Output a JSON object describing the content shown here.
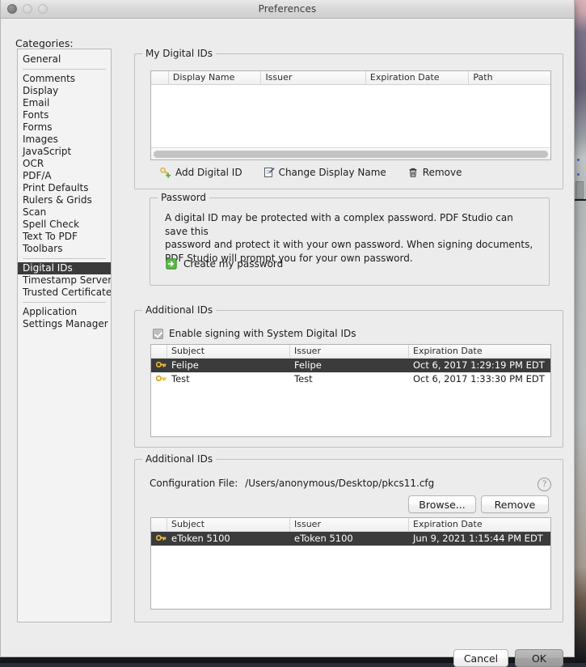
{
  "window": {
    "title": "Preferences",
    "traffic_lights": [
      "close-button",
      "minimize-button",
      "zoom-button"
    ]
  },
  "sidebar": {
    "label": "Categories:",
    "groups": [
      {
        "items": [
          {
            "label": "General",
            "selected": false
          }
        ]
      },
      {
        "items": [
          {
            "label": "Comments",
            "selected": false
          },
          {
            "label": "Display",
            "selected": false
          },
          {
            "label": "Email",
            "selected": false
          },
          {
            "label": "Fonts",
            "selected": false
          },
          {
            "label": "Forms",
            "selected": false
          },
          {
            "label": "Images",
            "selected": false
          },
          {
            "label": "JavaScript",
            "selected": false
          },
          {
            "label": "OCR",
            "selected": false
          },
          {
            "label": "PDF/A",
            "selected": false
          },
          {
            "label": "Print Defaults",
            "selected": false
          },
          {
            "label": "Rulers & Grids",
            "selected": false
          },
          {
            "label": "Scan",
            "selected": false
          },
          {
            "label": "Spell Check",
            "selected": false
          },
          {
            "label": "Text To PDF",
            "selected": false
          },
          {
            "label": "Toolbars",
            "selected": false
          }
        ]
      },
      {
        "items": [
          {
            "label": "Digital IDs",
            "selected": true
          },
          {
            "label": "Timestamp Servers",
            "selected": false
          },
          {
            "label": "Trusted Certificates",
            "selected": false
          }
        ]
      },
      {
        "items": [
          {
            "label": "Application",
            "selected": false
          },
          {
            "label": "Settings Manager",
            "selected": false
          }
        ]
      }
    ]
  },
  "my_digital_ids": {
    "legend": "My Digital IDs",
    "columns": [
      "Display Name",
      "Issuer",
      "Expiration Date",
      "Path"
    ],
    "rows": [],
    "toolbar": [
      {
        "label": "Add Digital ID",
        "icon": "add-key-icon"
      },
      {
        "label": "Change Display Name",
        "icon": "edit-note-icon"
      },
      {
        "label": "Remove",
        "icon": "trash-icon"
      }
    ]
  },
  "password": {
    "legend": "Password",
    "description": "A digital ID may be protected with a complex password. PDF Studio can save this\npassword and protect it with your own password. When signing documents,\nPDF Studio will prompt you for your own password.",
    "create_link": "Create my password",
    "create_link_icon": "green-arrow-icon"
  },
  "additional_ids_system": {
    "legend": "Additional IDs",
    "checkbox_label": "Enable signing with System Digital IDs",
    "checkbox_checked": true,
    "columns": [
      "Subject",
      "Issuer",
      "Expiration Date"
    ],
    "rows": [
      {
        "icon": "key-icon",
        "subject": "Felipe",
        "issuer": "Felipe",
        "expiration": "Oct 6, 2017 1:29:19 PM EDT",
        "selected": true
      },
      {
        "icon": "key-icon",
        "subject": "Test",
        "issuer": "Test",
        "expiration": "Oct 6, 2017 1:33:30 PM EDT",
        "selected": false
      }
    ]
  },
  "additional_ids_pkcs11": {
    "legend": "Additional IDs",
    "config_label": "Configuration File:",
    "config_value": "/Users/anonymous/Desktop/pkcs11.cfg",
    "help_icon": "help-question-icon",
    "browse_label": "Browse...",
    "remove_label": "Remove",
    "columns": [
      "Subject",
      "Issuer",
      "Expiration Date"
    ],
    "rows": [
      {
        "icon": "key-icon",
        "subject": "eToken 5100",
        "issuer": "eToken 5100",
        "expiration": "Jun 9, 2021 1:15:44 PM EDT",
        "selected": true
      }
    ]
  },
  "footer": {
    "cancel_label": "Cancel",
    "ok_label": "OK"
  },
  "colors": {
    "window_bg": "#ececec",
    "selection": "#3b3b3b",
    "key_gold": "#e8b93f",
    "green": "#4caf3f",
    "border": "#c0c0c0"
  }
}
